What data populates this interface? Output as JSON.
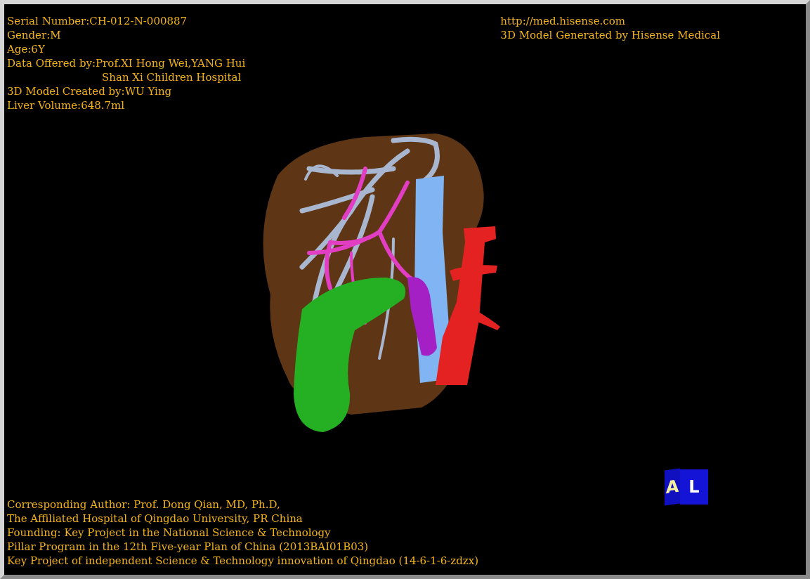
{
  "info_top_left": [
    {
      "text": "Serial Number:CH-012-N-000887"
    },
    {
      "text": "Gender:M"
    },
    {
      "text": "Age:6Y"
    },
    {
      "text": "Data Offered by:Prof.XI Hong Wei,YANG Hui",
      "continuation": "Shan Xi Children Hospital"
    },
    {
      "text": "3D Model Created by:WU Ying"
    },
    {
      "text": "Liver Volume:648.7ml"
    }
  ],
  "info_top_right": [
    "http://med.hisense.com",
    "3D Model Generated by Hisense Medical"
  ],
  "info_bottom": [
    "Corresponding Author: Prof. Dong Qian, MD, Ph.D,",
    "The Affiliated Hospital of Qingdao University, PR China",
    "Founding: Key Project in the National Science & Technology",
    "Pillar Program in the 12th Five-year Plan of China (2013BAI01B03)",
    "Key Project of independent Science & Technology innovation of Qingdao (14-6-1-6-zdzx)"
  ],
  "orientation_cube": {
    "front": "A",
    "side": "L"
  }
}
